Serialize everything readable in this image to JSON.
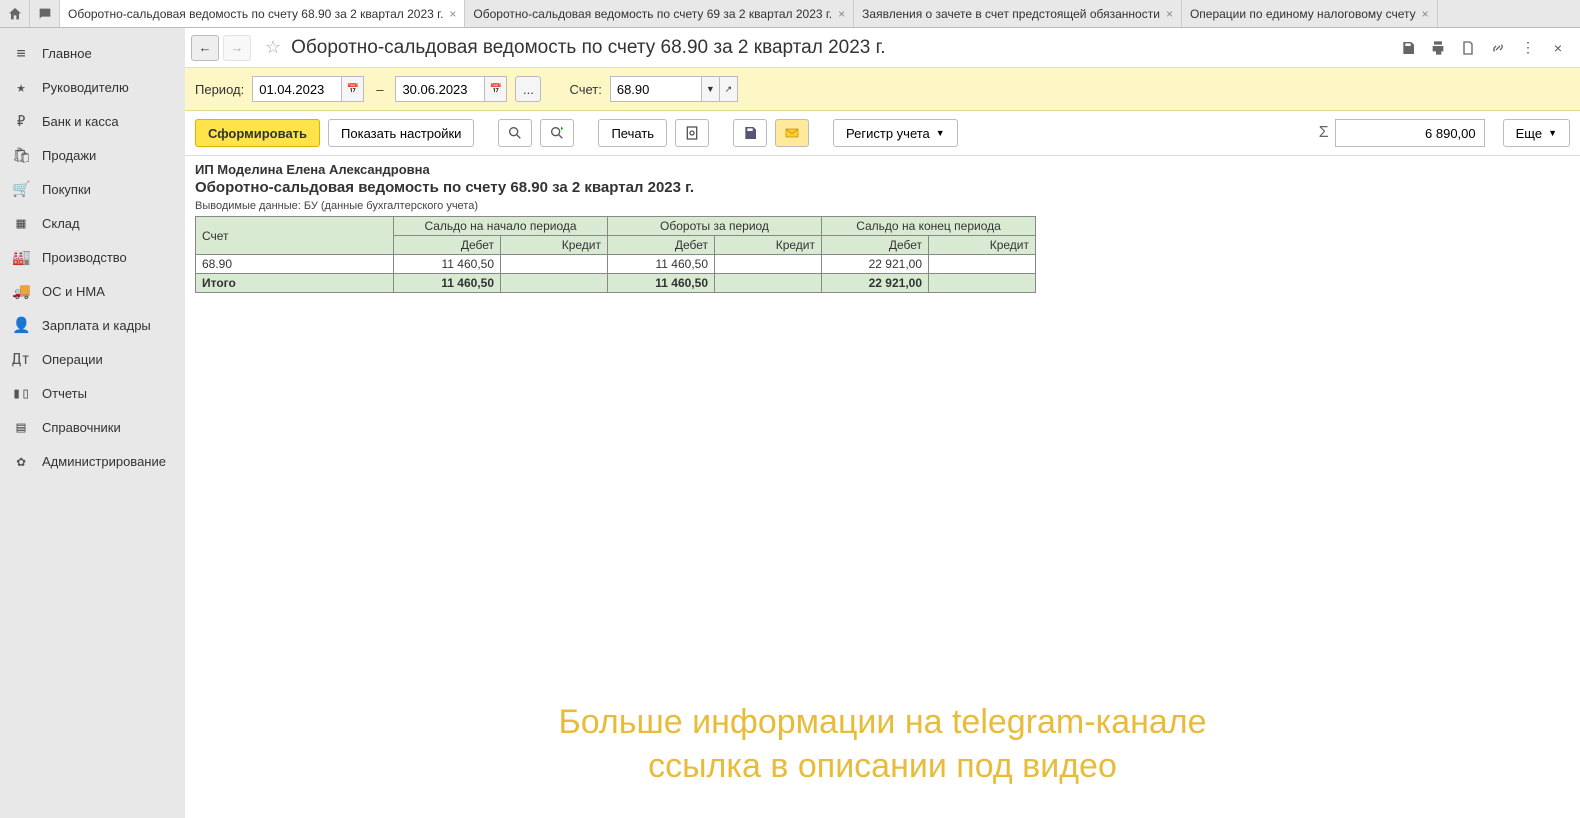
{
  "tabs": [
    {
      "label": "Оборотно-сальдовая ведомость по счету 68.90 за 2 квартал 2023 г.",
      "active": true
    },
    {
      "label": "Оборотно-сальдовая ведомость по счету 69 за 2 квартал 2023 г.",
      "active": false
    },
    {
      "label": "Заявления о зачете в счет предстоящей обязанности",
      "active": false
    },
    {
      "label": "Операции по единому налоговому счету",
      "active": false
    }
  ],
  "sidebar": [
    {
      "label": "Главное"
    },
    {
      "label": "Руководителю"
    },
    {
      "label": "Банк и касса"
    },
    {
      "label": "Продажи"
    },
    {
      "label": "Покупки"
    },
    {
      "label": "Склад"
    },
    {
      "label": "Производство"
    },
    {
      "label": "ОС и НМА"
    },
    {
      "label": "Зарплата и кадры"
    },
    {
      "label": "Операции"
    },
    {
      "label": "Отчеты"
    },
    {
      "label": "Справочники"
    },
    {
      "label": "Администрирование"
    }
  ],
  "page_title": "Оборотно-сальдовая ведомость по счету 68.90 за 2 квартал 2023 г.",
  "filter": {
    "period_label": "Период:",
    "date_from": "01.04.2023",
    "date_to": "30.06.2023",
    "dash": "–",
    "dots": "...",
    "account_label": "Счет:",
    "account": "68.90"
  },
  "toolbar": {
    "generate": "Сформировать",
    "settings": "Показать настройки",
    "print": "Печать",
    "register": "Регистр учета",
    "more": "Еще",
    "sum": "6 890,00"
  },
  "report": {
    "org": "ИП Моделина Елена Александровна",
    "title": "Оборотно-сальдовая ведомость по счету 68.90 за 2 квартал 2023 г.",
    "sub": "Выводимые данные: БУ (данные бухгалтерского учета)",
    "cols": {
      "acct": "Счет",
      "start": "Сальдо на начало периода",
      "turn": "Обороты за период",
      "end": "Сальдо на конец периода",
      "debit": "Дебет",
      "credit": "Кредит"
    },
    "rows": [
      {
        "acct": "68.90",
        "start_debit": "11 460,50",
        "start_credit": "",
        "turn_debit": "11 460,50",
        "turn_credit": "",
        "end_debit": "22 921,00",
        "end_credit": ""
      }
    ],
    "total_label": "Итого",
    "totals": {
      "start_debit": "11 460,50",
      "start_credit": "",
      "turn_debit": "11 460,50",
      "turn_credit": "",
      "end_debit": "22 921,00",
      "end_credit": ""
    }
  },
  "watermark": {
    "line1": "Больше информации на telegram-канале",
    "line2": "ссылка в описании под видео"
  }
}
